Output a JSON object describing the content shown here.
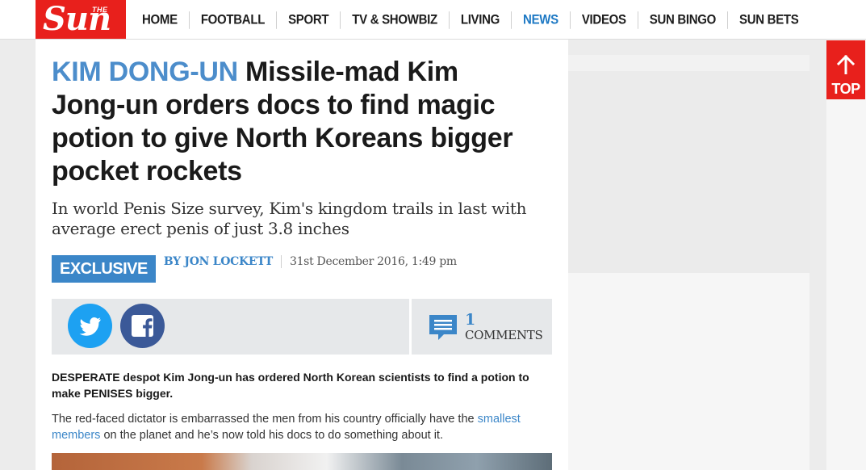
{
  "brand": {
    "the": "THE",
    "name": "Sun",
    "color": "#e8201c"
  },
  "nav": {
    "items": [
      {
        "label": "HOME",
        "active": false
      },
      {
        "label": "FOOTBALL",
        "active": false
      },
      {
        "label": "SPORT",
        "active": false
      },
      {
        "label": "TV & SHOWBIZ",
        "active": false
      },
      {
        "label": "LIVING",
        "active": false
      },
      {
        "label": "NEWS",
        "active": true
      },
      {
        "label": "VIDEOS",
        "active": false
      },
      {
        "label": "SUN BINGO",
        "active": false
      },
      {
        "label": "SUN BETS",
        "active": false
      }
    ],
    "active_color": "#1e79c4"
  },
  "article": {
    "kicker": "KIM DONG-UN",
    "headline": " Missile-mad Kim Jong-un orders docs to find magic potion to give North Koreans bigger pocket rockets",
    "standfirst": "In world Penis Size survey, Kim's kingdom trails in last with average erect penis of just 3.8 inches",
    "badge": "EXCLUSIVE",
    "author": "BY JON LOCKETT",
    "date": "31st December 2016, 1:49 pm",
    "lead": "DESPERATE despot Kim Jong-un has ordered North Korean scientists to find a potion to make PENISES bigger.",
    "body_before_link": "The red-faced dictator is embarrassed the men from his country officially have the ",
    "body_link": "smallest members",
    "body_after_link": " on the planet and he’s now told his docs to do something about it."
  },
  "share": {
    "twitter_icon": "twitter-icon",
    "facebook_icon": "facebook-icon",
    "comments_count": "1",
    "comments_label": "COMMENTS",
    "twitter_color": "#1da1f2",
    "facebook_color": "#3b5998",
    "accent": "#3b86c8"
  },
  "back_to_top": {
    "label": "TOP",
    "icon": "arrow-up-icon"
  }
}
